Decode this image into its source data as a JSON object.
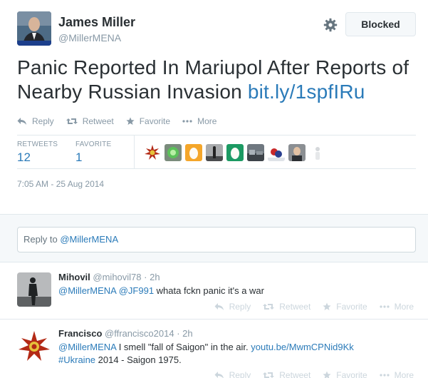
{
  "author": {
    "name": "James Miller",
    "handle": "@MillerMENA"
  },
  "header": {
    "blocked_label": "Blocked"
  },
  "tweet": {
    "text": "Panic Reported In Mariupol After Reports of Nearby Russian Invasion ",
    "link": "bit.ly/1spfIRu",
    "timestamp": "7:05 AM - 25 Aug 2014"
  },
  "actions": {
    "reply": "Reply",
    "retweet": "Retweet",
    "favorite": "Favorite",
    "more": "More"
  },
  "stats": {
    "retweets_label": "RETWEETS",
    "retweets_value": "12",
    "favorites_label": "FAVORITE",
    "favorites_value": "1"
  },
  "reply_box": {
    "prefix": "Reply to ",
    "mention": "@MillerMENA"
  },
  "replies": [
    {
      "name": "Mihovil",
      "handle": "@mihovil78",
      "time": "· 2h",
      "mention1": "@MillerMENA",
      "mention2": "@JF991",
      "text": " whata fckn panic it's a war"
    },
    {
      "name": "Francisco",
      "handle": "@ffrancisco2014",
      "time": "· 2h",
      "mention1": "@MillerMENA",
      "text1": " I smell \"fall of Saigon\" in the air. ",
      "link": "youtu.be/MwmCPNid9Kk",
      "hashtag": "#Ukraine",
      "text2": " 2014 - Saigon 1975."
    }
  ],
  "colors": {
    "link": "#2b7bb9",
    "muted": "#8899a6",
    "border": "#e1e8ed"
  }
}
